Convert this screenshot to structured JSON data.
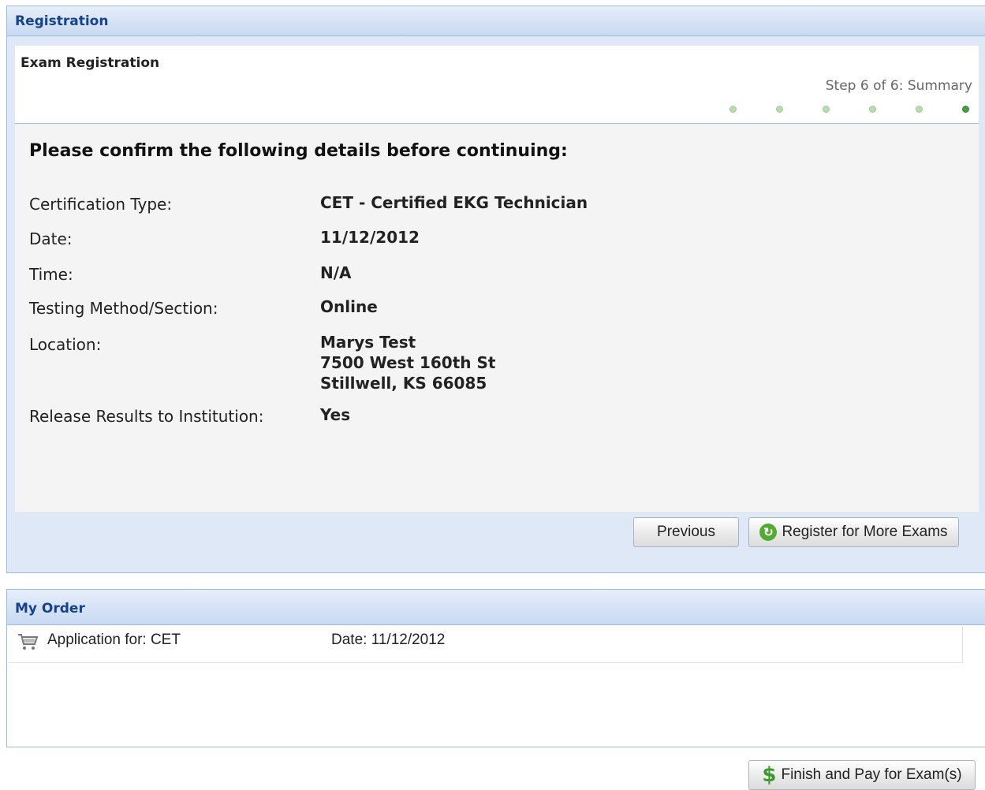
{
  "registration_panel": {
    "title": "Registration",
    "wizard_title": "Exam Registration",
    "step_label": "Step 6 of 6: Summary",
    "steps_total": 6,
    "step_current": 6,
    "confirm_heading": "Please confirm the following details before continuing:",
    "fields": {
      "certification_type": {
        "label": "Certification Type:",
        "value": "CET - Certified EKG Technician"
      },
      "date": {
        "label": "Date:",
        "value": "11/12/2012"
      },
      "time": {
        "label": "Time:",
        "value": "N/A"
      },
      "testing_method": {
        "label": "Testing Method/Section:",
        "value": "Online"
      },
      "location": {
        "label": "Location:",
        "line1": "Marys Test",
        "line2": "7500 West 160th St",
        "line3": "Stillwell, KS 66085"
      },
      "release_results": {
        "label": "Release Results to Institution:",
        "value": "Yes"
      }
    },
    "buttons": {
      "previous": "Previous",
      "register_more": "Register for More Exams"
    }
  },
  "order_panel": {
    "title": "My Order",
    "items": [
      {
        "application": "Application for: CET",
        "date": "Date: 11/12/2012",
        "icon": "cart-icon"
      }
    ]
  },
  "finish_button": "Finish and Pay for Exam(s)",
  "colors": {
    "header_text": "#15428b",
    "panel_border": "#99bbe8",
    "panel_bg": "#dfe8f6",
    "step_dot": "#b8dcb0",
    "step_dot_active": "#4a9a4a"
  }
}
